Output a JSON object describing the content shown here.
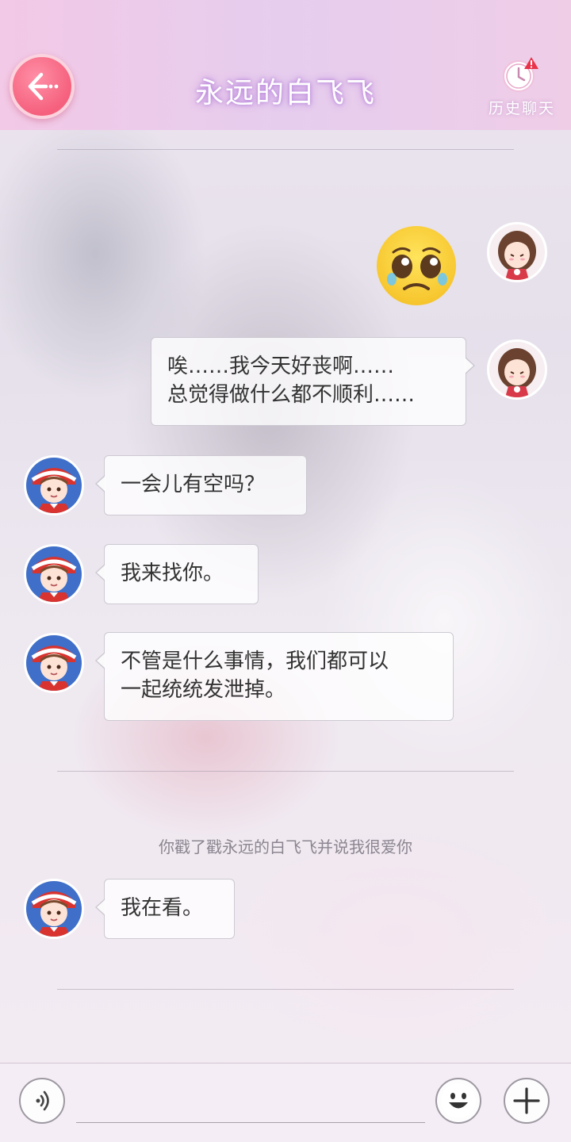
{
  "header": {
    "title": "永远的白飞飞",
    "history_label": "历史聊天",
    "back_icon": "back-arrow-icon",
    "history_icon": "clock-alert-icon"
  },
  "messages": [
    {
      "side": "right",
      "type": "emoji",
      "emoji": "pleading-face"
    },
    {
      "side": "right",
      "type": "text",
      "lines": [
        "唉……我今天好丧啊……",
        "总觉得做什么都不顺利……"
      ]
    },
    {
      "side": "left",
      "type": "text",
      "lines": [
        "一会儿有空吗？"
      ]
    },
    {
      "side": "left",
      "type": "text",
      "lines": [
        "我来找你。"
      ]
    },
    {
      "side": "left",
      "type": "text",
      "lines": [
        "不管是什么事情，我们都可以",
        "一起统统发泄掉。"
      ]
    },
    {
      "side": "left",
      "type": "text",
      "lines": [
        "我在看。"
      ]
    }
  ],
  "system_notice": "你戳了戳永远的白飞飞并说我很爱你",
  "bottom_bar": {
    "voice_icon": "voice-icon",
    "emoji_icon": "smiley-icon",
    "plus_icon": "plus-icon"
  },
  "colors": {
    "back_button": "#f5607d",
    "header_bg": "#e6cdee",
    "alert": "#e8344a"
  }
}
